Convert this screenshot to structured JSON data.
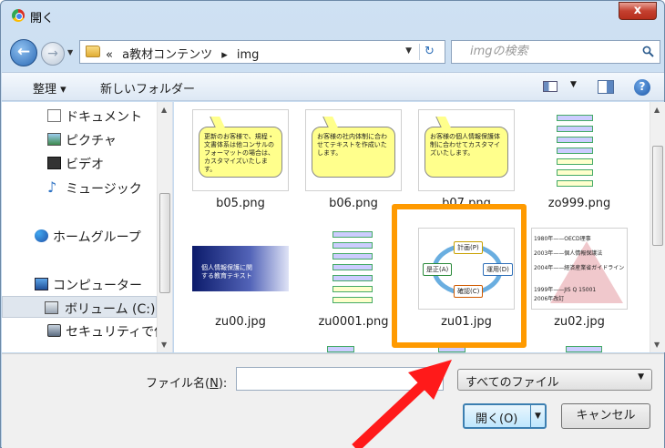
{
  "window": {
    "title": "開く",
    "close_label": "x"
  },
  "address": {
    "crumb_overflow": "«",
    "crumbs": [
      "a教材コンテンツ",
      "▸",
      "img"
    ],
    "search_placeholder": "imgの検索"
  },
  "toolbar": {
    "organize_label": "整理 ▾",
    "new_folder_label": "新しいフォルダー",
    "help_label": "?"
  },
  "navpane": {
    "items": [
      {
        "label": "ドキュメント",
        "icon": "document-icon"
      },
      {
        "label": "ピクチャ",
        "icon": "picture-icon"
      },
      {
        "label": "ビデオ",
        "icon": "video-icon"
      },
      {
        "label": "ミュージック",
        "icon": "music-icon"
      },
      {
        "label": "ホームグループ",
        "icon": "homegroup-icon"
      },
      {
        "label": "コンピューター",
        "icon": "computer-icon"
      },
      {
        "label": "ボリューム (C:)",
        "icon": "drive-icon",
        "selected": true
      },
      {
        "label": "セキュリティで保",
        "icon": "network-drive-icon"
      }
    ]
  },
  "files": {
    "items": [
      {
        "name": "b05.png",
        "bubble": "更新のお客様で、規程・文書体系は他コンサルのフォーマットの場合は、カスタマイズいたします。"
      },
      {
        "name": "b06.png",
        "bubble": "お客様の社内体制に合わせてテキストを作成いたします。"
      },
      {
        "name": "b07.png",
        "bubble": "お客様の個人情報保護体制に合わせてカスタマイズいたします。"
      },
      {
        "name": "zo999.png"
      },
      {
        "name": "zu00.jpg",
        "banner": "個人情報保護に関する教育テキスト"
      },
      {
        "name": "zu0001.png"
      },
      {
        "name": "zu01.jpg",
        "cycle": [
          "計画(P)",
          "運用(D)",
          "確認(C)",
          "是正(A)"
        ]
      },
      {
        "name": "zu02.jpg",
        "timeline": [
          "1980年——OECD理事",
          "2003年——個人情報保護法",
          "2004年——経済産業省ガイドライン",
          "1999年——JIS Q 15001",
          "2006年改訂"
        ]
      }
    ]
  },
  "bottom": {
    "filename_label_pre": "ファイル名(",
    "filename_label_key": "N",
    "filename_label_post": "):",
    "filename_value": "",
    "filetype_value": "すべてのファイル",
    "open_label": "開く(O)",
    "cancel_label": "キャンセル"
  },
  "colors": {
    "highlight": "#ff9a00",
    "arrow": "#ff1a1a"
  }
}
